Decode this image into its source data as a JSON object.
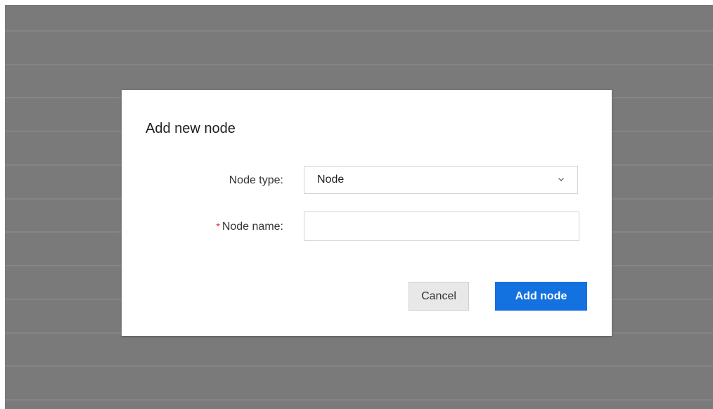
{
  "dialog": {
    "title": "Add new node",
    "fields": {
      "node_type": {
        "label": "Node type:",
        "value": "Node"
      },
      "node_name": {
        "required_mark": "*",
        "label": "Node name:",
        "value": "",
        "placeholder": ""
      }
    },
    "buttons": {
      "cancel_label": "Cancel",
      "submit_label": "Add node"
    }
  },
  "colors": {
    "overlay": "#7a7a7a",
    "primary": "#1471e0",
    "required": "#e12e2e"
  },
  "icons": {
    "select_chevron": "chevron-down-icon"
  }
}
